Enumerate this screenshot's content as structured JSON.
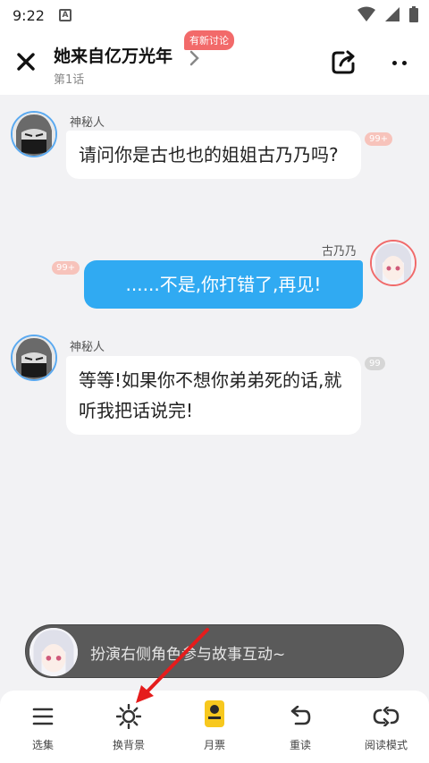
{
  "status_bar": {
    "time": "9:22",
    "app_icon": "A"
  },
  "header": {
    "title": "她来自亿万光年",
    "subtitle": "第1话",
    "badge": "有新讨论"
  },
  "messages": [
    {
      "sender": "神秘人",
      "text": "请问你是古也也的姐姐古乃乃吗?",
      "count": "99+",
      "side": "left"
    },
    {
      "sender": "古乃乃",
      "text": "......不是,你打错了,再见!",
      "count": "99+",
      "side": "right"
    },
    {
      "sender": "神秘人",
      "text": "等等!如果你不想你弟弟死的话,就听我把话说完!",
      "count": "99",
      "side": "left"
    }
  ],
  "roleplay": {
    "prompt": "扮演右侧角色参与故事互动~"
  },
  "bottom_nav": [
    {
      "label": "选集",
      "icon": "list-icon"
    },
    {
      "label": "换背景",
      "icon": "brightness-icon"
    },
    {
      "label": "月票",
      "icon": "monthly-ticket-icon"
    },
    {
      "label": "重读",
      "icon": "reread-icon"
    },
    {
      "label": "阅读模式",
      "icon": "reading-mode-icon"
    }
  ],
  "colors": {
    "accent_blue": "#30aaf2",
    "badge_red": "#f26a6a",
    "background": "#f2f2f4"
  }
}
